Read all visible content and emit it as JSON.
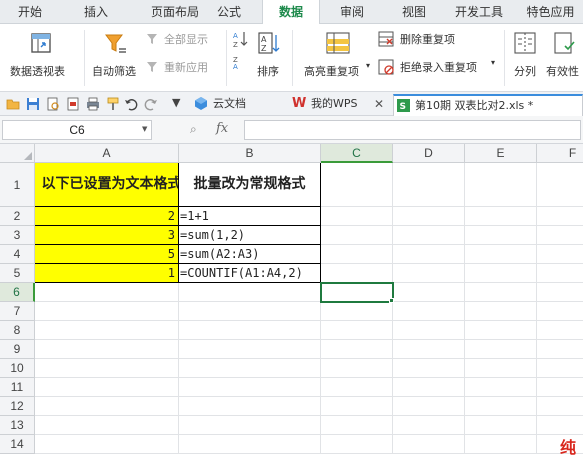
{
  "menu": {
    "tabs": [
      "开始",
      "插入",
      "页面布局",
      "公式",
      "数据",
      "审阅",
      "视图",
      "开发工具",
      "特色应用"
    ],
    "active": "数据"
  },
  "ribbon": {
    "pivot_table": "数据透视表",
    "auto_filter": "自动筛选",
    "show_all": "全部显示",
    "reapply": "重新应用",
    "sort": "排序",
    "highlight_dup": "高亮重复项",
    "delete_dup": "删除重复项",
    "reject_dup": "拒绝录入重复项",
    "split_column": "分列",
    "validity": "有效性"
  },
  "doc_tabs": [
    {
      "label": "云文档"
    },
    {
      "label": "我的WPS"
    },
    {
      "label": "第10期 双表比对2.xls *"
    }
  ],
  "formula_bar": {
    "name_box": "C6",
    "fx": "fx",
    "value": ""
  },
  "sheet": {
    "columns": [
      "A",
      "B",
      "C",
      "D",
      "E",
      "F"
    ],
    "rows": [
      "1",
      "2",
      "3",
      "4",
      "5",
      "6",
      "7",
      "8",
      "9",
      "10",
      "11",
      "12",
      "13",
      "14"
    ],
    "a1": "以下已设置为文本格式",
    "b1": "批量改为常规格式",
    "a_values": [
      "2",
      "3",
      "5",
      "1"
    ],
    "b_formulas": [
      "=1+1",
      "=sum(1,2)",
      "=sum(A2:A3)",
      "=COUNTIF(A1:A4,2)"
    ],
    "selected_cell": "C6"
  },
  "watermark": "纯",
  "colors": {
    "accent": "#1e8a4c",
    "highlight": "#ffff00",
    "selection": "#1f7a3f"
  }
}
